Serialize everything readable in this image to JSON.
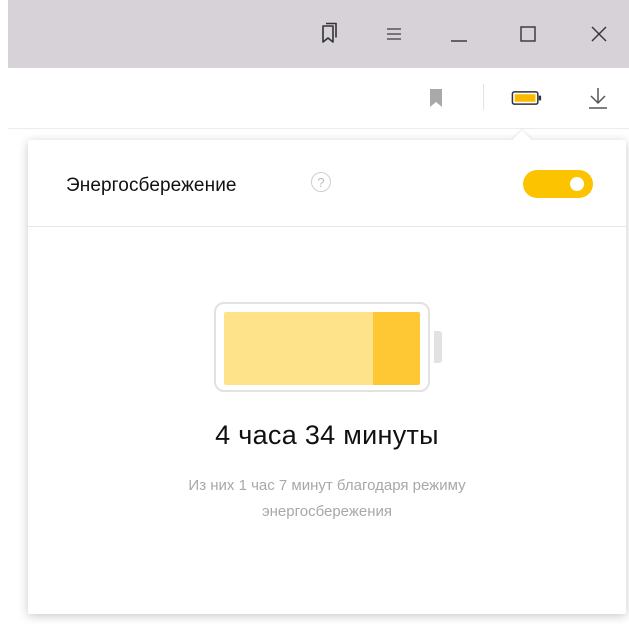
{
  "titlebar": {
    "buttons": [
      {
        "name": "collections",
        "icon": "bookmarks-collections-icon"
      },
      {
        "name": "menu",
        "icon": "hamburger-menu-icon"
      },
      {
        "name": "minimize",
        "icon": "minimize-icon"
      },
      {
        "name": "maximize",
        "icon": "maximize-icon"
      },
      {
        "name": "close",
        "icon": "close-icon"
      }
    ],
    "background": "#d6d2d8"
  },
  "toolbar": {
    "items": [
      "bookmark-icon",
      "battery-icon",
      "download-icon"
    ]
  },
  "power_saving_popup": {
    "title": "Энергосбережение",
    "help_label": "?",
    "toggle_on": true,
    "accent_color": "#fcc400",
    "battery": {
      "level_fraction": 1.0,
      "saved_fraction": 0.24,
      "fill_color": "#fee38a",
      "saved_color": "#fdc834"
    },
    "remaining_time": "4 часа 34 минуты",
    "note": "Из них 1 час 7 минут благодаря режиму энергосбережения"
  }
}
